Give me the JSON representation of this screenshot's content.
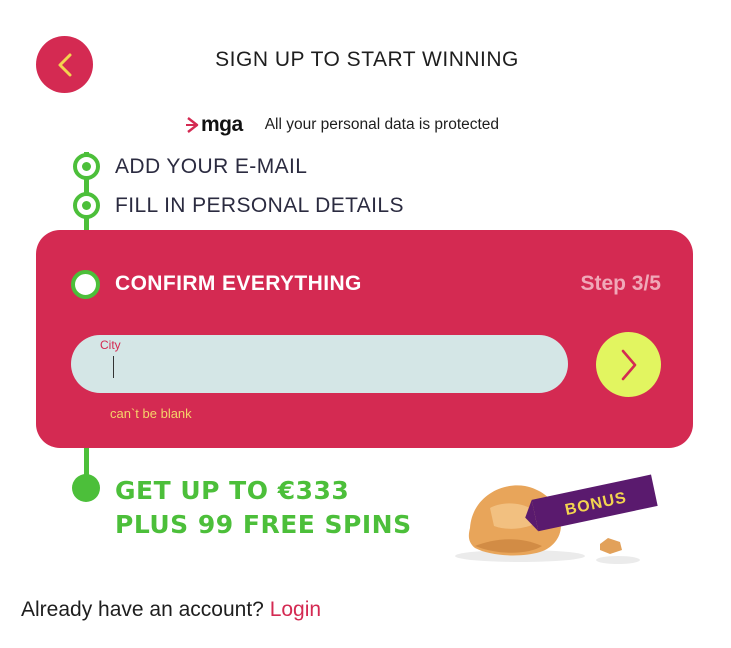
{
  "header": {
    "back_icon": "chevron-left-icon",
    "title": "SIGN UP TO START WINNING"
  },
  "security": {
    "logo_text": "mga",
    "message": "All your personal data is protected"
  },
  "steps": [
    {
      "label": "ADD YOUR E-MAIL",
      "status": "done"
    },
    {
      "label": "FILL IN PERSONAL DETAILS",
      "status": "done"
    },
    {
      "label": "CONFIRM EVERYTHING",
      "status": "current"
    }
  ],
  "confirm": {
    "step_counter": "Step 3/5",
    "city_label": "City",
    "city_value": "",
    "error": "can`t be blank",
    "next_icon": "chevron-right-icon"
  },
  "bonus": {
    "line1": "GET UP TO €333",
    "line2": "PLUS 99 FREE SPINS",
    "badge": "BONUS"
  },
  "footer": {
    "prompt": "Already have an account?",
    "login_label": "Login"
  },
  "colors": {
    "brand_red": "#d42a52",
    "step_green": "#4cbf3a",
    "next_button": "#e2f560",
    "input_bg": "#d4e6e6",
    "error_text": "#f5d36a",
    "bonus_purple": "#5a1a6e"
  }
}
